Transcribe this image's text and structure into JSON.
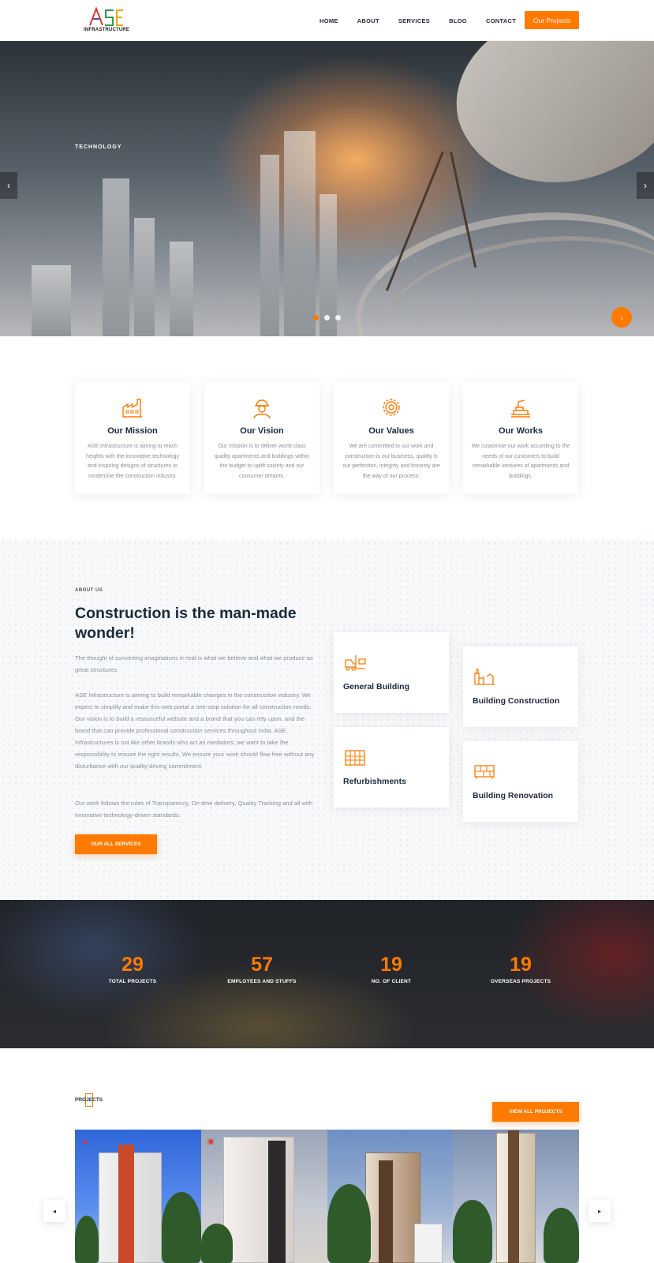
{
  "header": {
    "logo_letters": "ASE",
    "logo_text": "INFRASTRUCTURE",
    "nav": [
      "HOME",
      "ABOUT",
      "SERVICES",
      "BLOG",
      "CONTACT"
    ],
    "cta": "Our Projects"
  },
  "hero": {
    "label": "TECHNOLOGY",
    "prev_icon": "‹",
    "next_icon": "›",
    "scroll_icon": "↓",
    "active_dot": 1,
    "dot_count": 3
  },
  "values": [
    {
      "icon": "factory-icon",
      "title": "Our Mission",
      "text": "ASE Infrastructure is aiming to reach heights with the innovative technology and inspiring designs of structures to modernise the construction industry."
    },
    {
      "icon": "worker-icon",
      "title": "Our Vision",
      "text": "Our mission is to deliver world class quality apartments and buildings within the budget to uplift society and our consumer dreams."
    },
    {
      "icon": "gear-icon",
      "title": "Our Values",
      "text": "We are committed to our work and construction is our business, quality is our perfection, integrity and honesty are the way of our process."
    },
    {
      "icon": "crane-icon",
      "title": "Our Works",
      "text": "We customise our work according to the needs of our customers to build remarkable ventures of apartments and buildings."
    }
  ],
  "about": {
    "label": "ABOUT US",
    "title": "Construction is the man-made wonder!",
    "p1": "The thought of converting imaginations in real is what we believe and what we produce as great structures.",
    "p2": "ASE Infrastructure is aiming to build remarkable changes in the construction industry. We expect to simplify and make this web portal a one-stop solution for all construction needs. Our vision is to build a resourceful website and a brand that you can rely upon, and the brand that can provide professional construction services throughout India. ASE Infrastructures is not like other brands who act as mediators; we want to take the responsibility to ensure the right results. We ensure your work should flow free without any disturbance with our quality driving commitment.",
    "p3": "Our work follows the rules of Transparency, On-time delivery, Quality Tracking and all with innovative technology-driven standards.",
    "button": "OUR ALL SERVICES",
    "services": [
      {
        "icon": "forklift-icon",
        "title": "General Building"
      },
      {
        "icon": "building-icon",
        "title": "Building Construction"
      },
      {
        "icon": "scaffold-icon",
        "title": "Refurbishments"
      },
      {
        "icon": "bricks-icon",
        "title": "Building Renovation"
      }
    ]
  },
  "stats": [
    {
      "number": "29",
      "label": "TOTAL PROJECTS"
    },
    {
      "number": "57",
      "label": "EMPLOYEES AND STUFFS"
    },
    {
      "number": "19",
      "label": "NO. OF CLIENT"
    },
    {
      "number": "19",
      "label": "OVERSEAS PROJECTS"
    }
  ],
  "projects": {
    "label": "PROJECTS",
    "button": "VIEW ALL PROJECTS",
    "prev_icon": "◂",
    "next_icon": "▸",
    "colors": {
      "accent": "#ff7a00"
    }
  }
}
